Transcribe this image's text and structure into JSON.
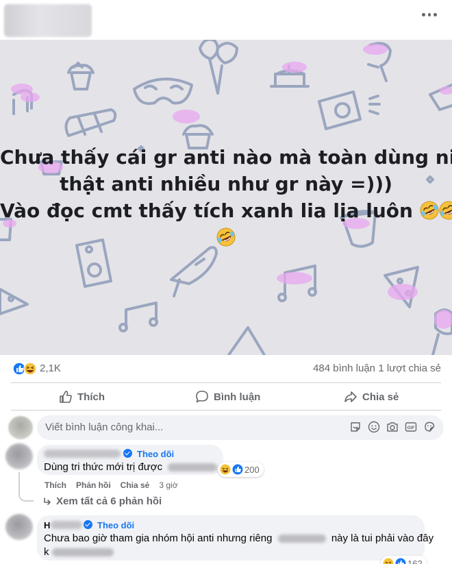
{
  "post": {
    "header": {
      "more_icon": "more-horizontal-icon"
    },
    "banner": {
      "background": "#e4e3e8",
      "line1": "Chưa thấy cái gr anti nào mà toàn dùng nick",
      "line2": "thật anti nhiều như gr này =)))",
      "line3": "Vào đọc cmt thấy tích xanh lia lịa luôn",
      "emoji": "rolling-on-floor-laughing-emoji"
    },
    "stats": {
      "reactions": [
        "like-icon",
        "haha-icon"
      ],
      "reaction_count": "2,1K",
      "comments": "484 bình luận",
      "shares": "1 lượt chia sẻ"
    },
    "actions": {
      "like": "Thích",
      "comment": "Bình luận",
      "share": "Chia sẻ"
    },
    "composer": {
      "placeholder": "Viết bình luận công khai...",
      "tools": [
        "sticker-icon",
        "emoji-icon",
        "camera-icon",
        "gif-icon",
        "sticker-face-icon"
      ]
    },
    "comments": [
      {
        "follow": "Theo dõi",
        "text": "Dùng tri thức mới trị được",
        "reaction_count": "200",
        "meta": {
          "like": "Thích",
          "reply": "Phản hồi",
          "share": "Chia sẻ",
          "time": "3 giờ"
        },
        "view_replies": "Xem tất cả 6 phản hồi"
      },
      {
        "name_prefix": "H",
        "follow": "Theo dõi",
        "text_part1": "Chưa bao giờ tham gia nhóm hội anti nhưng riêng",
        "text_part2": "này là tui phải vào đây",
        "line2_prefix": "k",
        "reaction_count": "162"
      }
    ],
    "colors": {
      "accent": "#1877f2",
      "muted": "#65676b",
      "bubble": "#f0f2f5",
      "divider": "#ced0d4"
    }
  }
}
